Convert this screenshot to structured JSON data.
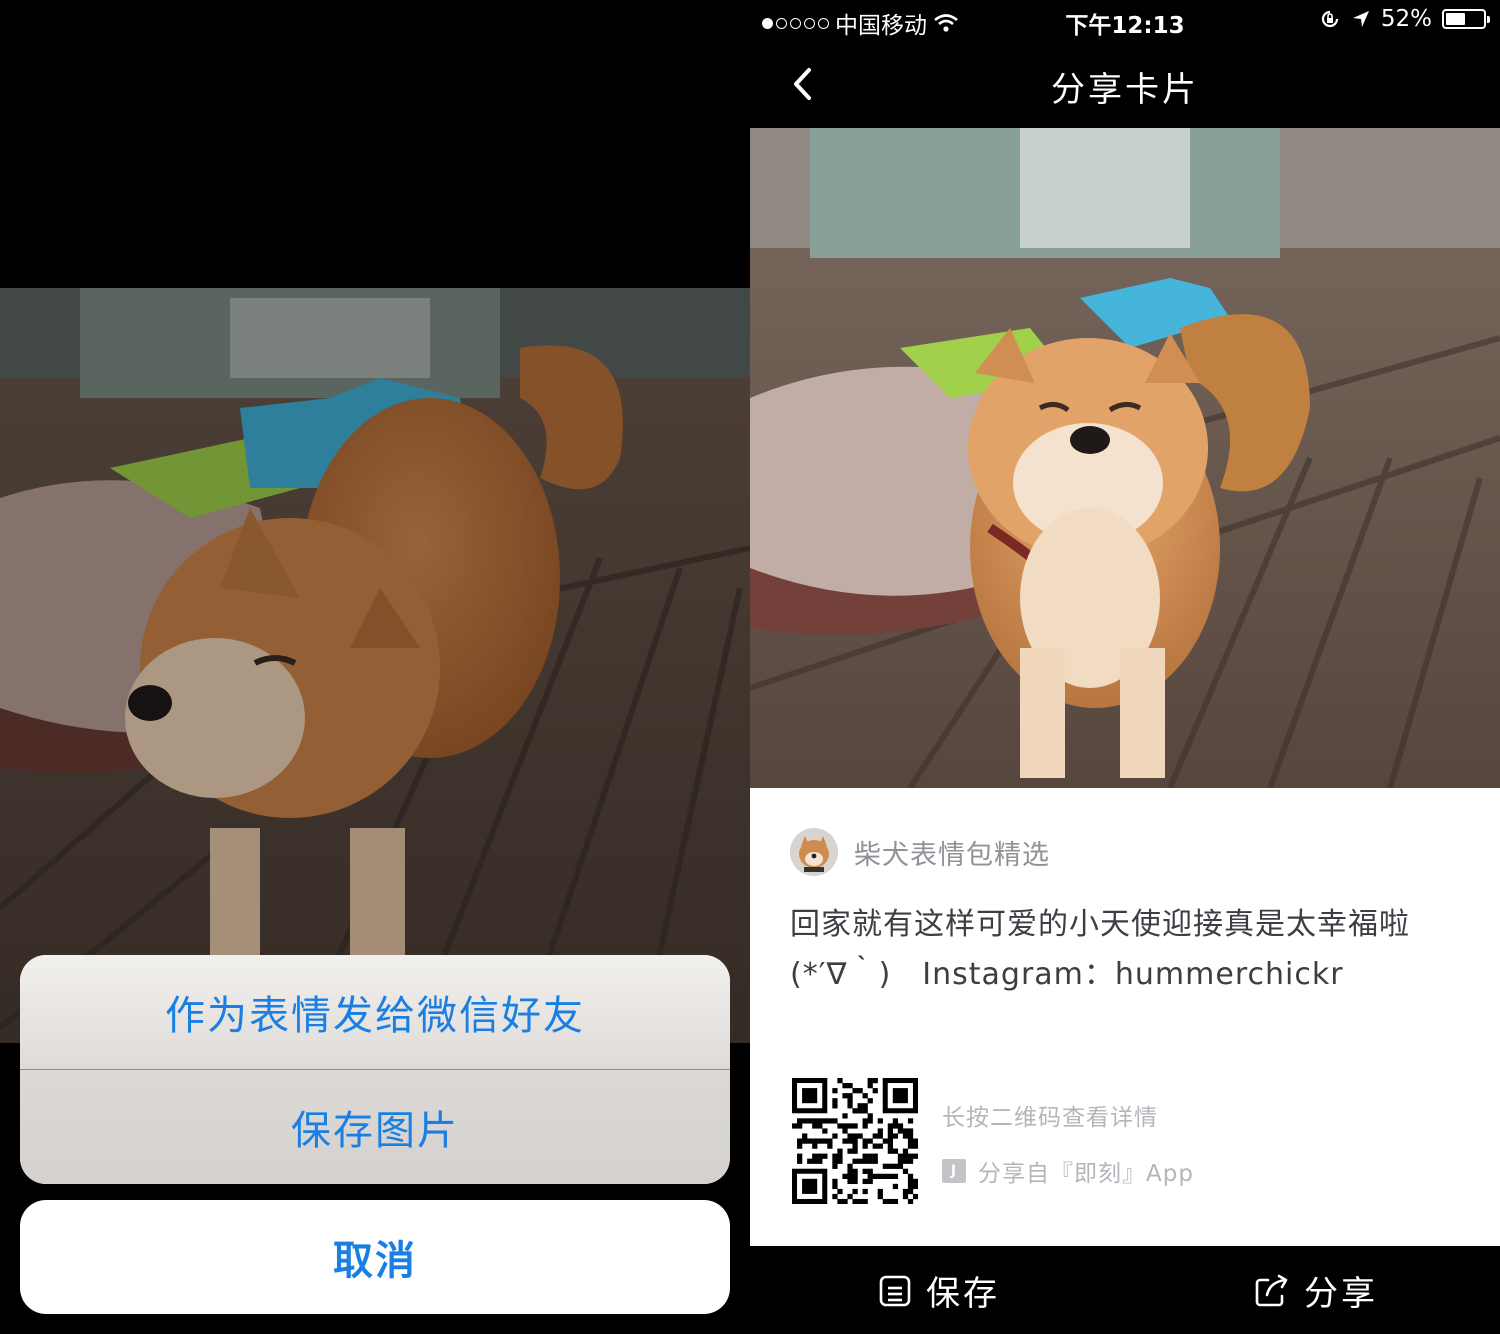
{
  "action_sheet": {
    "send_as_sticker_label": "作为表情发给微信好友",
    "save_image_label": "保存图片",
    "cancel_label": "取消"
  },
  "status_bar": {
    "carrier": "中国移动",
    "time": "下午12:13",
    "battery": "52%",
    "battery_level": 0.52
  },
  "nav": {
    "title": "分享卡片"
  },
  "card": {
    "author": "柴犬表情包精选",
    "text_line1": "回家就有这样可爱的小天使迎接真是太幸福啦",
    "text_line2": "(*′∇｀)　Instagram：hummerchickr",
    "qr_hint": "长按二维码查看详情",
    "source": "分享自『即刻』App",
    "source_logo_letter": "J"
  },
  "toolbar": {
    "save_label": "保存",
    "share_label": "分享"
  },
  "colors": {
    "action_blue": "#1a7fe3",
    "muted_gray": "#b3b6ba"
  }
}
